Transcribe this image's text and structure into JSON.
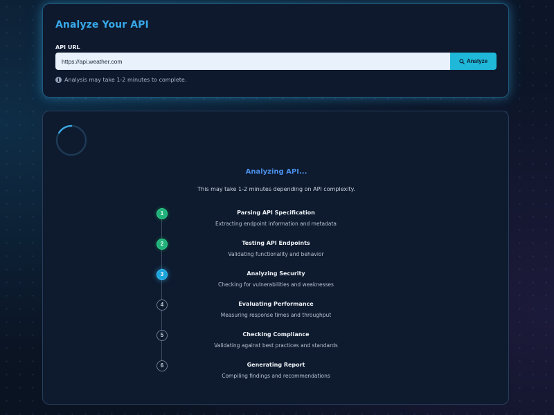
{
  "analyze": {
    "title": "Analyze Your API",
    "url_label": "API URL",
    "url_value": "https://api.weather.com",
    "button_label": "Analyze",
    "hint": "Analysis may take 1-2 minutes to complete."
  },
  "progress": {
    "title": "Analyzing API...",
    "subtitle": "This may take 1-2 minutes depending on API complexity.",
    "steps": [
      {
        "number": "1",
        "title": "Parsing API Specification",
        "description": "Extracting endpoint information and metadata",
        "status": "done"
      },
      {
        "number": "2",
        "title": "Testing API Endpoints",
        "description": "Validating functionality and behavior",
        "status": "done"
      },
      {
        "number": "3",
        "title": "Analyzing Security",
        "description": "Checking for vulnerabilities and weaknesses",
        "status": "active"
      },
      {
        "number": "4",
        "title": "Evaluating Performance",
        "description": "Measuring response times and throughput",
        "status": "pending"
      },
      {
        "number": "5",
        "title": "Checking Compliance",
        "description": "Validating against best practices and standards",
        "status": "pending"
      },
      {
        "number": "6",
        "title": "Generating Report",
        "description": "Compiling findings and recommendations",
        "status": "pending"
      }
    ]
  },
  "icons": {
    "search": "search-icon",
    "info": "info-icon",
    "spinner": "loading-spinner-icon"
  },
  "colors": {
    "accent": "#38a8e8",
    "button": "#1fb8d8",
    "done": "#22b07a",
    "active": "#1ba3dc",
    "pending_border": "#6b7a8f",
    "analyzing_title": "#4a8fe8"
  }
}
